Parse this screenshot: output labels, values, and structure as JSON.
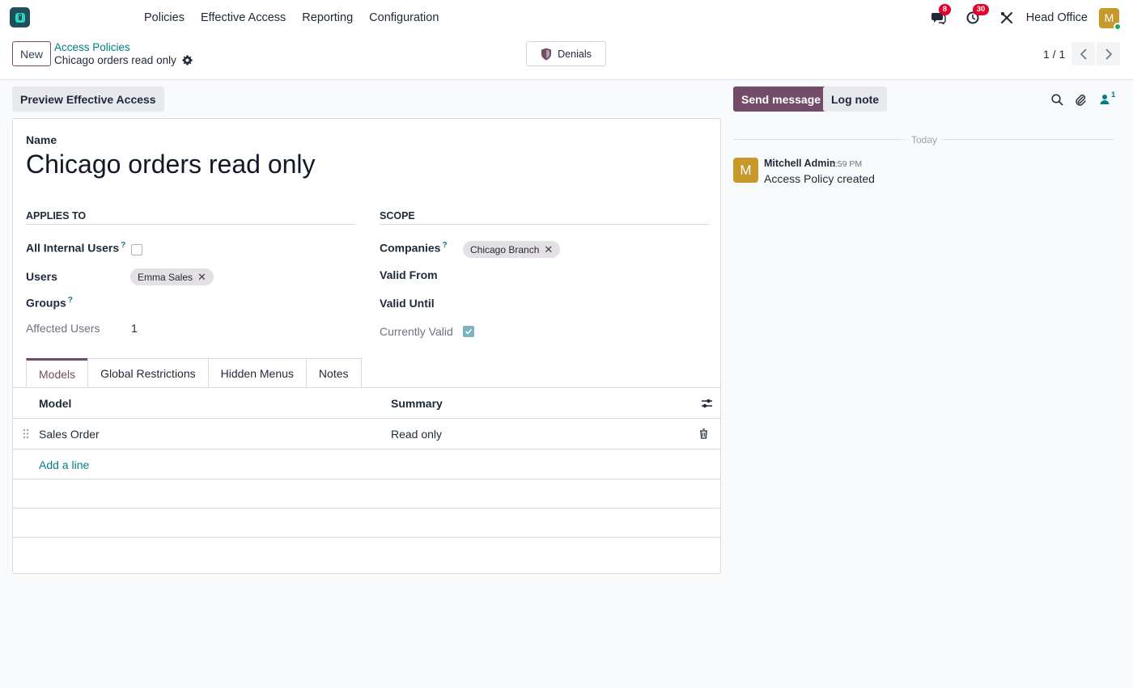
{
  "navbar": {
    "menu": [
      "Policies",
      "Effective Access",
      "Reporting",
      "Configuration"
    ],
    "messages_count": "8",
    "activities_count": "30",
    "company": "Head Office",
    "user_initial": "M"
  },
  "control_panel": {
    "new_label": "New",
    "breadcrumb_parent": "Access Policies",
    "breadcrumb_current": "Chicago orders read only",
    "denials_label": "Denials",
    "pager": "1 / 1"
  },
  "form": {
    "preview_label": "Preview Effective Access",
    "name_label": "Name",
    "name_value": "Chicago orders read only",
    "applies_to_title": "Applies To",
    "scope_title": "Scope",
    "fields": {
      "all_internal_users": "All Internal Users",
      "users": "Users",
      "groups": "Groups",
      "affected_users": "Affected Users",
      "companies": "Companies",
      "valid_from": "Valid From",
      "valid_until": "Valid Until",
      "currently_valid": "Currently Valid"
    },
    "help_mark": "?",
    "users_tag": "Emma Sales",
    "companies_tag": "Chicago Branch",
    "affected_users_value": "1",
    "tabs": [
      "Models",
      "Global Restrictions",
      "Hidden Menus",
      "Notes"
    ],
    "list": {
      "col_model": "Model",
      "col_summary": "Summary",
      "rows": [
        {
          "model": "Sales Order",
          "summary": "Read only"
        }
      ],
      "add_line": "Add a line"
    }
  },
  "chatter": {
    "send_label": "Send message",
    "log_label": "Log note",
    "followers_count": "1",
    "date_separator": "Today",
    "message": {
      "avatar_initial": "M",
      "author": "Mitchell Admin",
      "time": "5:59 PM",
      "body": "Access Policy created"
    }
  },
  "colors": {
    "brand": "#714b67",
    "link": "#017e84",
    "badge": "#e4002b",
    "avatar": "#c7982a"
  }
}
